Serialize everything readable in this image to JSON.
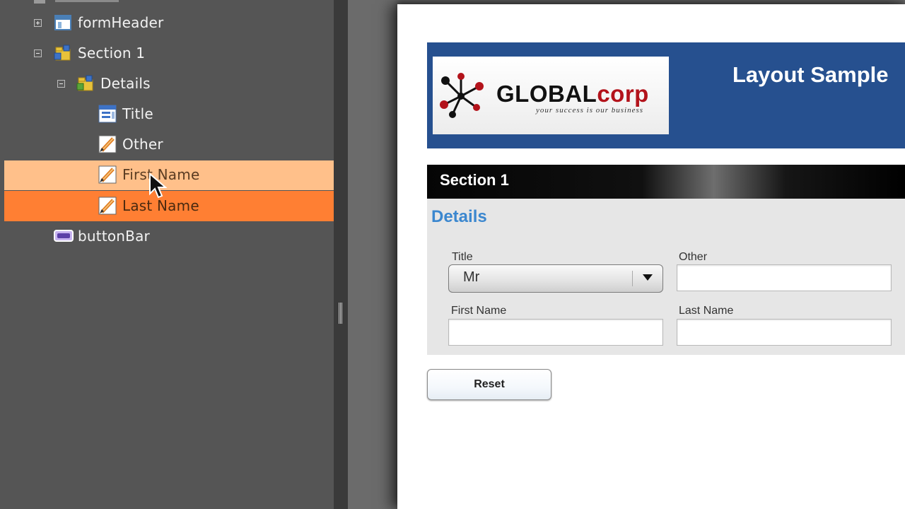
{
  "tree": {
    "items": [
      {
        "label": "formHeader"
      },
      {
        "label": "Section 1"
      },
      {
        "label": "Details"
      },
      {
        "label": "Title"
      },
      {
        "label": "Other"
      },
      {
        "label": "First Name"
      },
      {
        "label": "Last Name"
      },
      {
        "label": "buttonBar"
      }
    ]
  },
  "form": {
    "banner_title": "Layout Sample",
    "logo": {
      "brand_a": "GLOBAL",
      "brand_b": "corp",
      "tagline": "your success is our business"
    },
    "section_title": "Section 1",
    "details_title": "Details",
    "fields": {
      "title_label": "Title",
      "title_value": "Mr",
      "other_label": "Other",
      "first_name_label": "First Name",
      "last_name_label": "Last Name"
    },
    "reset_label": "Reset"
  },
  "colors": {
    "tree_bg": "#555555",
    "hover_row": "#ffc08a",
    "selected_row": "#ff7f33",
    "banner": "#26508f",
    "details_title": "#3b87cf",
    "logo_accent": "#b3131b"
  },
  "icons": {
    "formHeader": "form-header-icon",
    "section": "section-folder-icon",
    "details": "details-folder-icon",
    "title": "dropdown-field-icon",
    "text_field": "text-field-pencil-icon",
    "button_bar": "button-bar-icon"
  }
}
